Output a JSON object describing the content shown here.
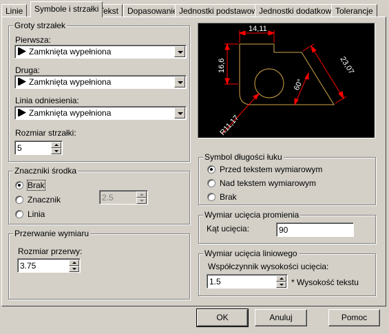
{
  "tabs": [
    "Linie",
    "Symbole i strzałki",
    "Tekst",
    "Dopasowanie",
    "Jednostki podstawowe",
    "Jednostki dodatkowe",
    "Tolerancje"
  ],
  "arrowheads": {
    "title": "Groty strzałek",
    "first_label": "Pierwsza:",
    "first_value": "Zamknięta wypełniona",
    "second_label": "Druga:",
    "second_value": "Zamknięta wypełniona",
    "leader_label": "Linia odniesienia:",
    "leader_value": "Zamknięta wypełniona",
    "size_label": "Rozmiar strzałki:",
    "size_value": "5"
  },
  "center_marks": {
    "title": "Znaczniki środka",
    "options": [
      "Brak",
      "Znacznik",
      "Linia"
    ],
    "selected": "Brak",
    "size_value": "2.5"
  },
  "dimension_break": {
    "title": "Przerwanie wymiaru",
    "size_label": "Rozmiar przerwy:",
    "size_value": "3.75"
  },
  "preview": {
    "dims": [
      "14,11",
      "16,6",
      "23,07",
      "60°",
      "R11,17"
    ],
    "line_color": "#d6a84a",
    "dim_color": "#ff0000"
  },
  "arc_length_symbol": {
    "title": "Symbol długości łuku",
    "options": [
      "Przed tekstem wymiarowym",
      "Nad tekstem wymiarowym",
      "Brak"
    ],
    "selected": "Przed tekstem wymiarowym"
  },
  "radius_jog": {
    "title": "Wymiar ucięcia promienia",
    "angle_label": "Kąt ucięcia:",
    "angle_value": "90"
  },
  "linear_jog": {
    "title": "Wymiar ucięcia liniowego",
    "factor_label": "Współczynnik wysokości ucięcia:",
    "factor_value": "1.5",
    "factor_suffix": "* Wysokość tekstu"
  },
  "buttons": {
    "ok": "OK",
    "cancel": "Anuluj",
    "help": "Pomoc"
  }
}
